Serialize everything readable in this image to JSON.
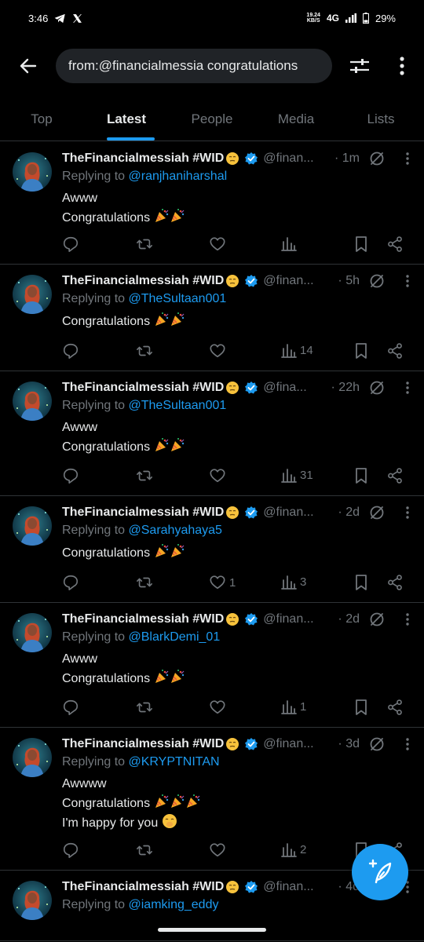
{
  "status_bar": {
    "time": "3:46",
    "net_speed_top": "19.24",
    "net_speed_bottom": "KB/S",
    "network": "4G",
    "battery": "29%"
  },
  "search": {
    "query": "from:@financialmessia congratulations"
  },
  "tabs": [
    {
      "label": "Top"
    },
    {
      "label": "Latest"
    },
    {
      "label": "People"
    },
    {
      "label": "Media"
    },
    {
      "label": "Lists"
    }
  ],
  "tweets": [
    {
      "name": "TheFinancialmessiah #WID",
      "handle": "@finan...",
      "time": "· 1m",
      "replying_prefix": "Replying to ",
      "replying_to": "@ranjhaniharshal",
      "lines": [
        "Awww",
        "Congratulations"
      ],
      "likes": "",
      "views": ""
    },
    {
      "name": "TheFinancialmessiah #WID",
      "handle": "@finan...",
      "time": "· 5h",
      "replying_prefix": "Replying to ",
      "replying_to": "@TheSultaan001",
      "lines": [
        "Congratulations"
      ],
      "likes": "",
      "views": "14"
    },
    {
      "name": "TheFinancialmessiah #WID",
      "handle": "@fina...",
      "time": "· 22h",
      "replying_prefix": "Replying to ",
      "replying_to": "@TheSultaan001",
      "lines": [
        "Awww",
        "Congratulations"
      ],
      "likes": "",
      "views": "31"
    },
    {
      "name": "TheFinancialmessiah #WID",
      "handle": "@finan...",
      "time": "· 2d",
      "replying_prefix": "Replying to ",
      "replying_to": "@Sarahyahaya5",
      "lines": [
        "Congratulations"
      ],
      "likes": "1",
      "views": "3"
    },
    {
      "name": "TheFinancialmessiah #WID",
      "handle": "@finan...",
      "time": "· 2d",
      "replying_prefix": "Replying to ",
      "replying_to": "@BlarkDemi_01",
      "lines": [
        "Awww",
        "Congratulations"
      ],
      "likes": "",
      "views": "1"
    },
    {
      "name": "TheFinancialmessiah #WID",
      "handle": "@finan...",
      "time": "· 3d",
      "replying_prefix": "Replying to ",
      "replying_to": "@KRYPTNITAN",
      "lines": [
        "Awwww",
        "Congratulations",
        "I'm happy for you"
      ],
      "likes": "",
      "views": "2"
    },
    {
      "name": "TheFinancialmessiah #WID",
      "handle": "@finan...",
      "time": "· 4d",
      "replying_prefix": "Replying to ",
      "replying_to": "@iamking_eddy",
      "lines": [],
      "likes": "",
      "views": ""
    }
  ],
  "colors": {
    "background": "#000000",
    "accent": "#1d9bf0",
    "muted": "#71767b",
    "divider": "#2f3336"
  }
}
